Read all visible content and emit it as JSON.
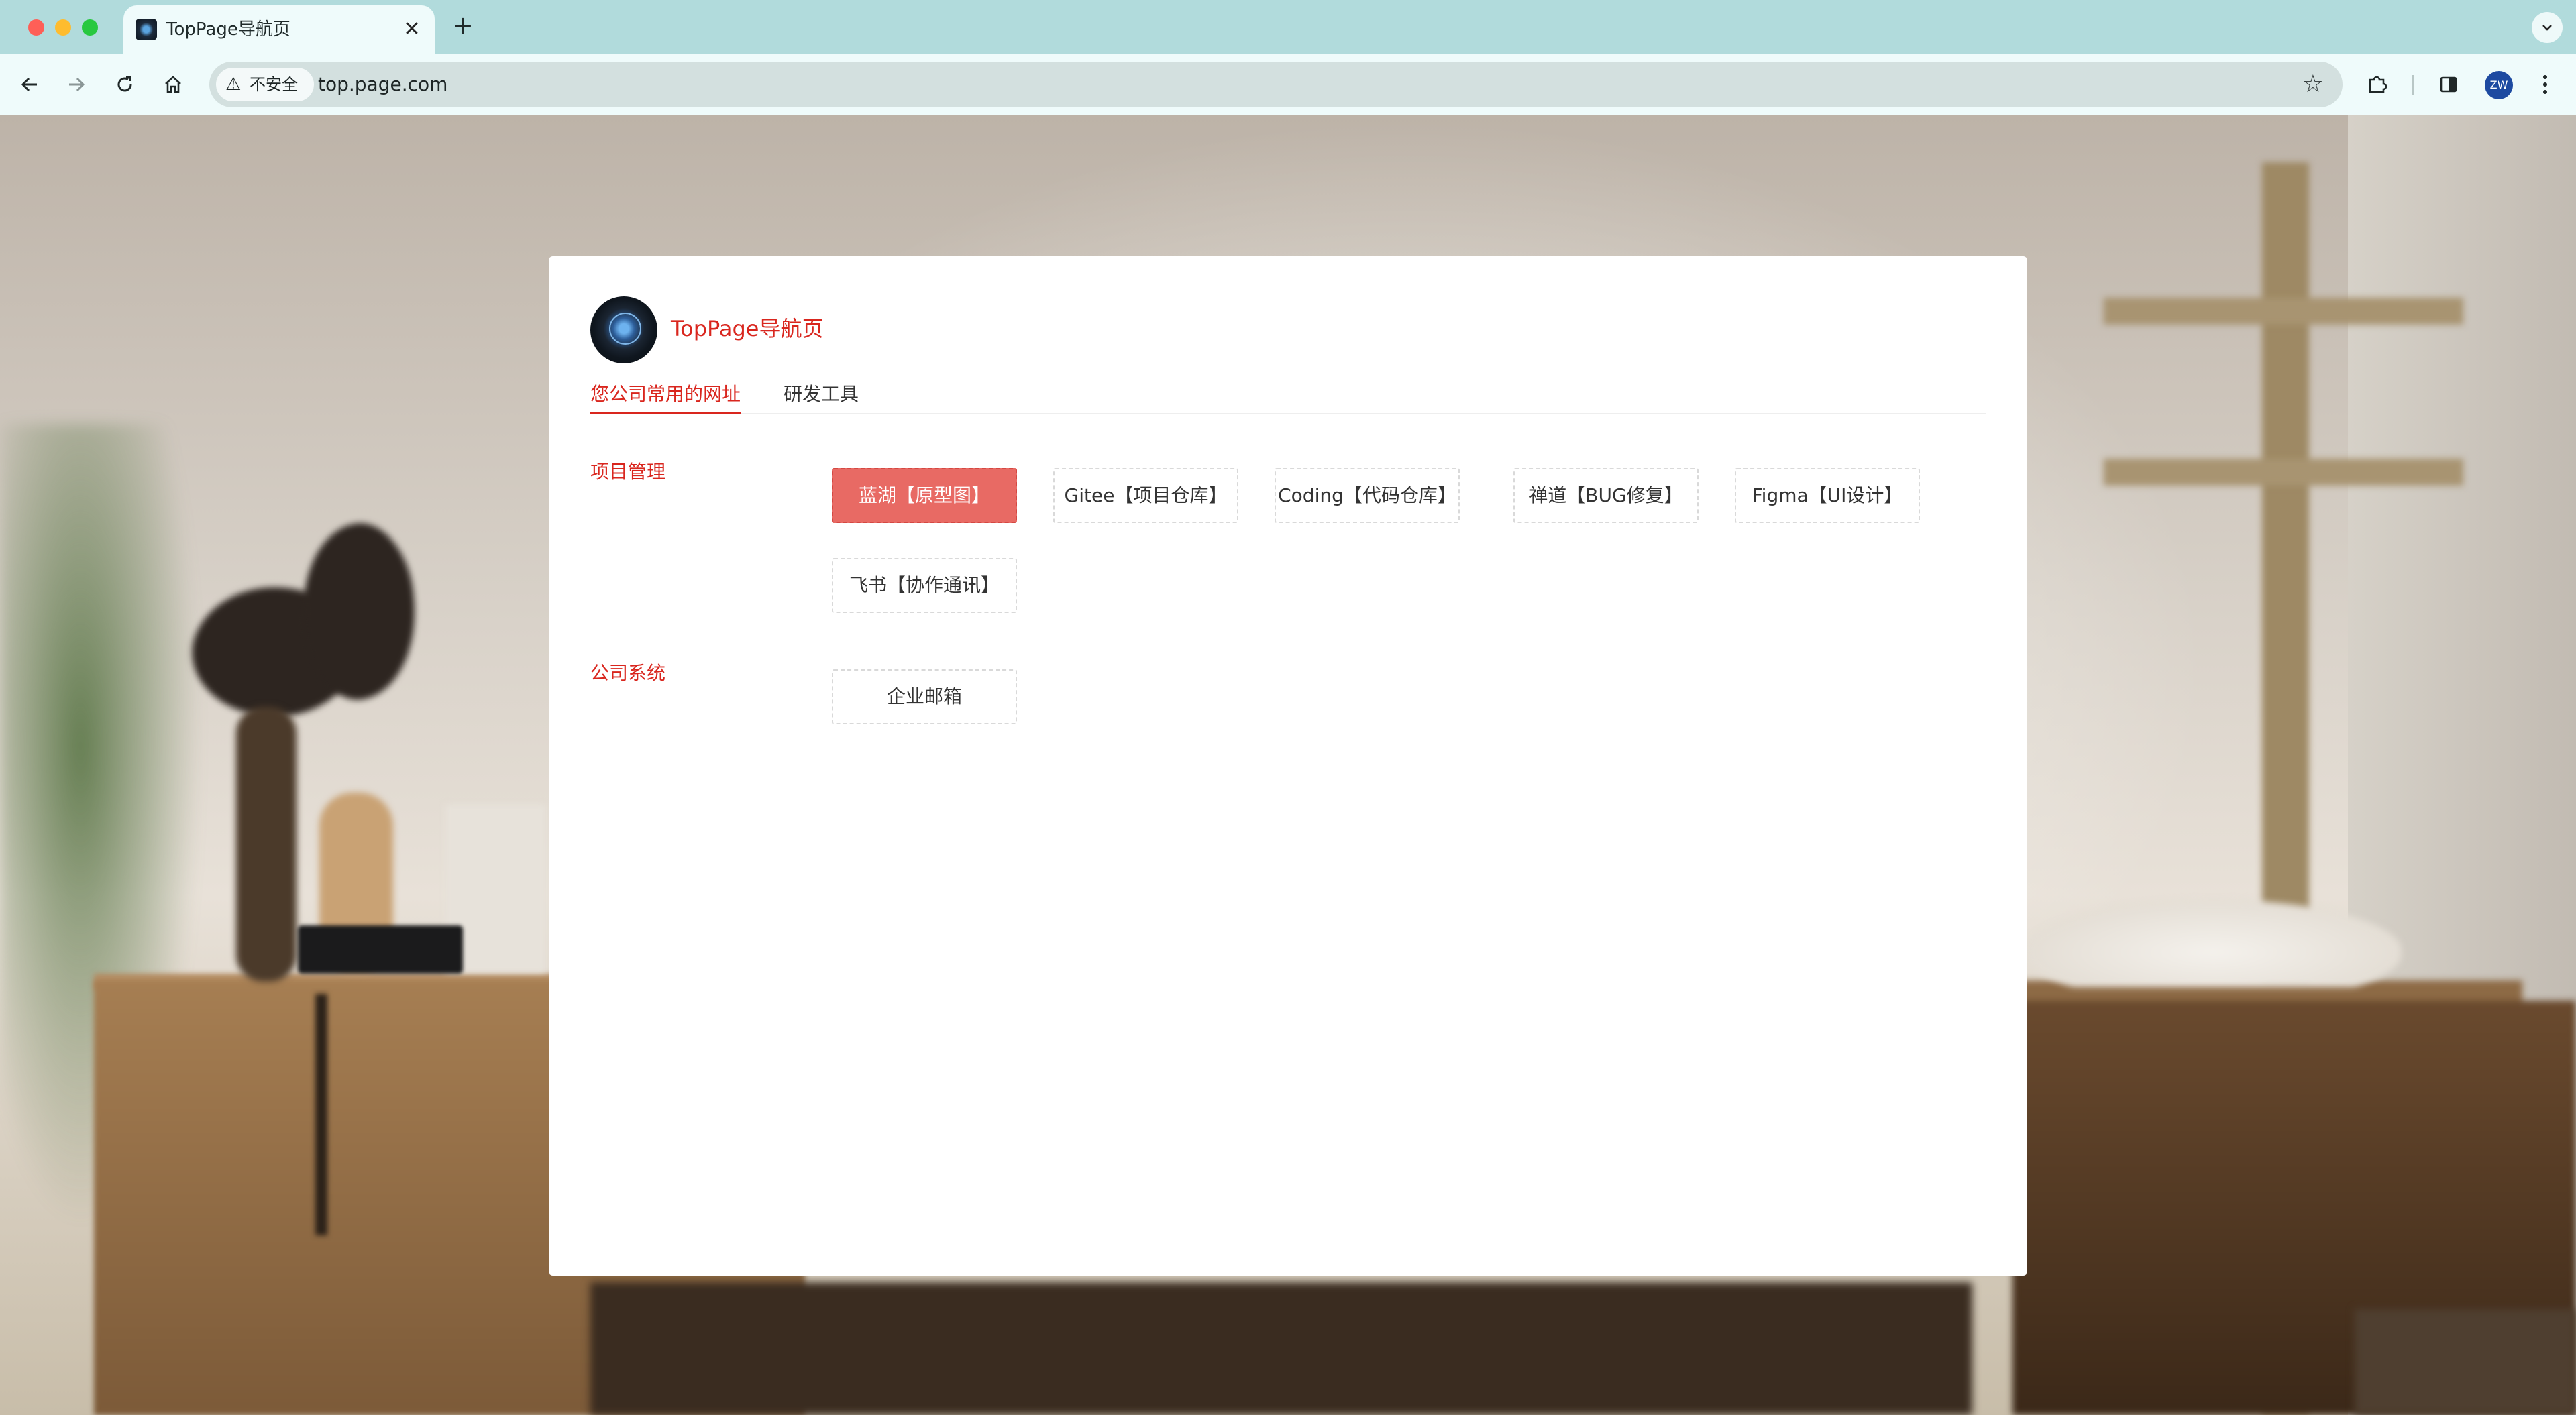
{
  "browser": {
    "tab_title": "TopPage导航页",
    "tab_close": "✕",
    "new_tab": "+",
    "security_label": "不安全",
    "url": "top.page.com",
    "profile_initials": "ZW"
  },
  "site": {
    "title": "TopPage导航页",
    "tabs": [
      {
        "label": "您公司常用的网址",
        "active": true
      },
      {
        "label": "研发工具",
        "active": false
      }
    ],
    "sections": [
      {
        "label": "项目管理",
        "links": [
          {
            "label": "蓝湖【原型图】",
            "active": true
          },
          {
            "label": "Gitee【项目仓库】",
            "active": false
          },
          {
            "label": "Coding【代码仓库】",
            "active": false
          },
          {
            "label": "禅道【BUG修复】",
            "active": false
          },
          {
            "label": "Figma【UI设计】",
            "active": false
          },
          {
            "label": "飞书【协作通讯】",
            "active": false
          }
        ]
      },
      {
        "label": "公司系统",
        "links": [
          {
            "label": "企业邮箱",
            "active": false
          }
        ]
      }
    ]
  },
  "colors": {
    "accent": "#d9261e",
    "active_button": "#e86a64",
    "titlebar": "#b1dbdc",
    "toolbar": "#effbfb"
  }
}
